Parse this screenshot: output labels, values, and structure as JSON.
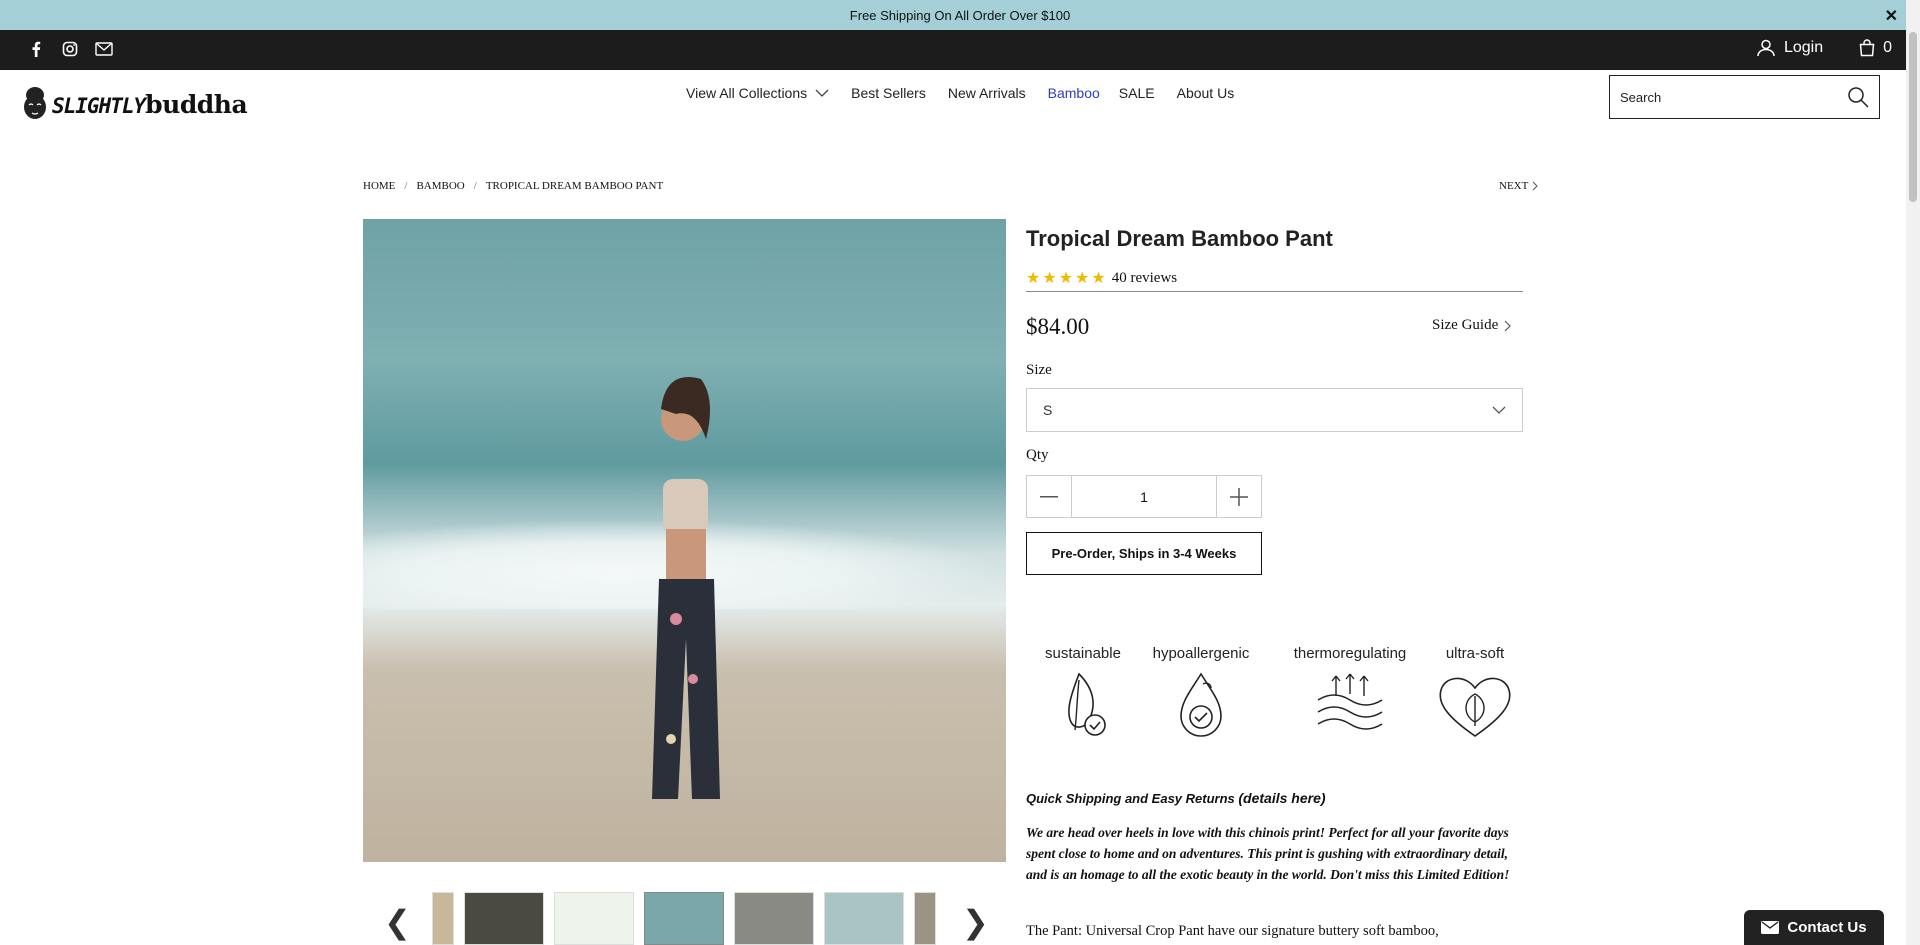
{
  "announcement": {
    "text": "Free Shipping On All Order Over $100",
    "close": "✕"
  },
  "topbar": {
    "login_label": "Login",
    "cart_count": "0"
  },
  "brand": {
    "part1": "SLIGHTLY",
    "part2": "buddha"
  },
  "nav": {
    "items": [
      "View All Collections",
      "Best Sellers",
      "New Arrivals",
      "Bamboo",
      "SALE",
      "About Us"
    ]
  },
  "search": {
    "placeholder": "Search"
  },
  "breadcrumb": {
    "items": [
      "HOME",
      "BAMBOO",
      "TROPICAL DREAM BAMBOO PANT"
    ],
    "sep": "/",
    "next": "NEXT"
  },
  "product": {
    "title": "Tropical Dream Bamboo Pant",
    "rating_value": 5,
    "reviews": "40 reviews",
    "price": "$84.00",
    "size_guide": "Size Guide",
    "size_label": "Size",
    "size_value": "S",
    "qty_label": "Qty",
    "qty_value": "1",
    "preorder_label": "Pre-Order, Ships in 3-4 Weeks"
  },
  "features": [
    "sustainable",
    "hypoallergenic",
    "thermoregulating",
    "ultra-soft"
  ],
  "shipping": {
    "text": "Quick Shipping and Easy Returns",
    "link": "(details here)"
  },
  "description": {
    "highlight": "We are head over heels in love with this chinois print!  Perfect for all your favorite days spent close to home and on adventures.  This print is gushing with extraordinary detail, and is an homage to all the exotic beauty in the world.  Don't miss this Limited Edition!",
    "body": "The Pant: Universal Crop Pant have our signature buttery soft bamboo,"
  },
  "carousel": {
    "prev": "❮",
    "next": "❯"
  },
  "contact": {
    "label": "Contact Us"
  },
  "colors": {
    "announce_bg": "#a5cfd6",
    "topbar_bg": "#1c1c1c",
    "nav_active": "#2c3fc0",
    "star": "#f2b900"
  }
}
